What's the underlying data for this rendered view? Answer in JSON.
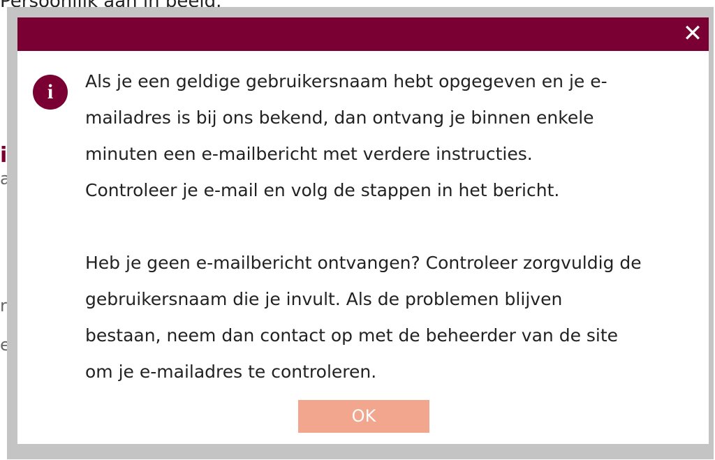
{
  "background": {
    "heading_fragment": "Persoonlijk aan in beeld.",
    "left_fragments": [
      "i",
      "a",
      "rs",
      "e"
    ]
  },
  "dialog": {
    "close_glyph": "✕",
    "info_glyph": "i",
    "paragraph_1": "Als je een geldige gebruikersnaam hebt opgegeven en je e-\nmailadres is bij ons bekend, dan ontvang je binnen enkele\nminuten een e-mailbericht met verdere instructies.\nControleer je e-mail en volg de stappen in het bericht.",
    "paragraph_2": "Heb je geen e-mailbericht ontvangen? Controleer zorgvuldig de\ngebruikersnaam die je invult. Als de problemen blijven\nbestaan, neem dan contact op met de beheerder van de site\nom je e-mailadres te controleren.",
    "ok_label": "OK"
  },
  "colors": {
    "header": "#7a0033",
    "ok_button": "#f2a68d",
    "overlay": "#c4c4c4"
  }
}
